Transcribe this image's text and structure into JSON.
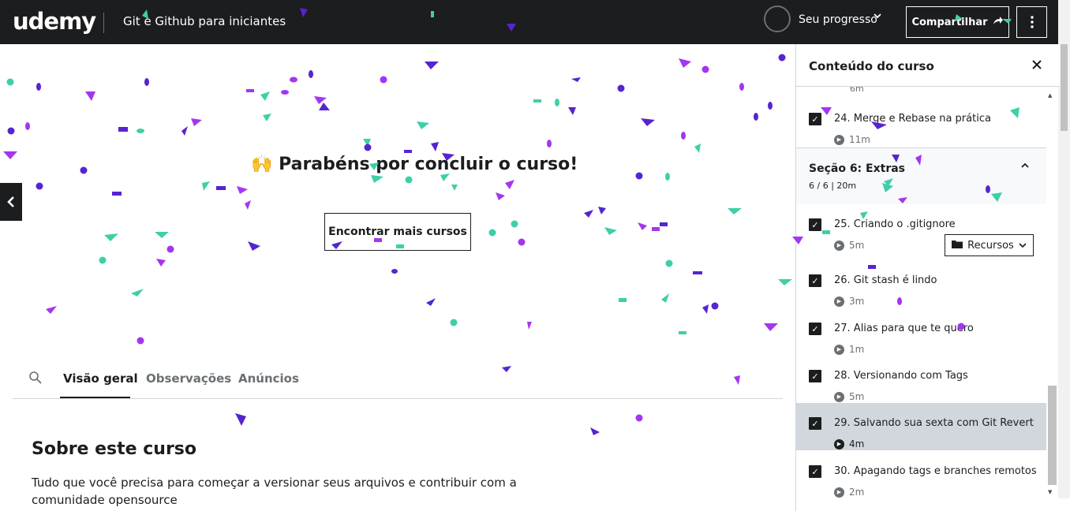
{
  "header": {
    "logo": "udemy",
    "course_title": "Git e Github para iniciantes",
    "progress_label": "Seu progresso",
    "share_label": "Compartilhar",
    "more_icon": "vertical-dots-icon"
  },
  "stage": {
    "congrats_text": "Parabéns por concluir o curso!",
    "congrats_emoji": "🙌",
    "find_courses_label": "Encontrar mais cursos",
    "prev_icon": "chevron-left-icon"
  },
  "tabs": {
    "items": [
      "Visão geral",
      "Observações",
      "Anúncios"
    ],
    "active": "Visão geral"
  },
  "about": {
    "title": "Sobre este curso",
    "text": "Tudo que você precisa para começar a versionar seus arquivos e contribuir com a comunidade opensource"
  },
  "sidebar": {
    "title": "Conteúdo do curso",
    "partial_top_meta": "6m",
    "section": {
      "title": "Seção 6: Extras",
      "meta": "6 / 6 | 20m"
    },
    "resources_label": "Recursos",
    "lectures": [
      {
        "title": "24. Merge e Rebase na prática",
        "duration": "11m"
      },
      {
        "title": "25. Criando o .gitignore",
        "duration": "5m"
      },
      {
        "title": "26. Git stash é lindo",
        "duration": "3m"
      },
      {
        "title": "27. Alias para que te quero",
        "duration": "1m"
      },
      {
        "title": "28. Versionando com Tags",
        "duration": "5m"
      },
      {
        "title": "29. Salvando sua sexta com Git Revert",
        "duration": "4m"
      },
      {
        "title": "30. Apagando tags e branches remotos",
        "duration": "2m"
      }
    ]
  },
  "colors": {
    "dark": "#1c1d1f",
    "confetti_purple": "#a435f0",
    "confetti_indigo": "#5624d0",
    "confetti_teal": "#3ecfa8"
  }
}
